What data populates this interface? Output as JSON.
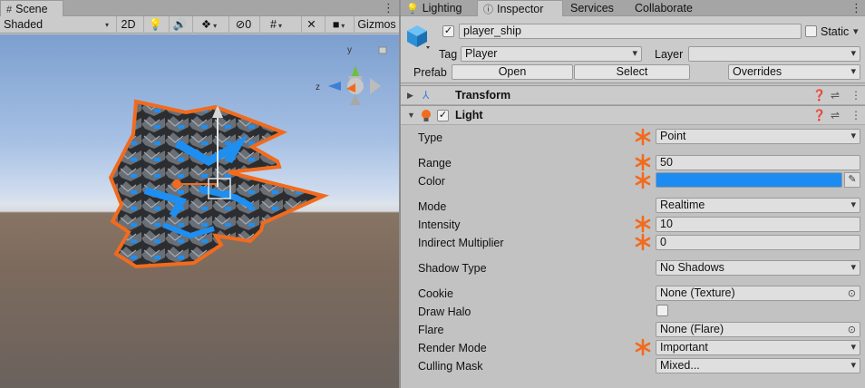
{
  "scene": {
    "tab_label": "Scene",
    "tab_icon": "grid-icon",
    "toolbar": {
      "shading_mode": "Shaded",
      "mode_2d": "2D",
      "hidden_count": "0",
      "gizmos_label": "Gizmos"
    },
    "axis_labels": {
      "y": "y",
      "z": "z"
    }
  },
  "inspector": {
    "tabs": [
      {
        "label": "Lighting",
        "icon": "lightbulb-icon"
      },
      {
        "label": "Inspector",
        "icon": "info-icon"
      },
      {
        "label": "Services"
      },
      {
        "label": "Collaborate"
      }
    ],
    "object_name": "player_ship",
    "static_label": "Static",
    "tag_label": "Tag",
    "tag_value": "Player",
    "layer_label": "Layer",
    "layer_value": "",
    "prefab_label": "Prefab",
    "prefab_open": "Open",
    "prefab_select": "Select",
    "prefab_overrides": "Overrides",
    "components": [
      {
        "name": "Transform",
        "expanded": false
      },
      {
        "name": "Light",
        "expanded": true,
        "enabled": true
      }
    ],
    "light_props": {
      "type_label": "Type",
      "type_value": "Point",
      "range_label": "Range",
      "range_value": "50",
      "color_label": "Color",
      "color_value": "#1d8cf2",
      "mode_label": "Mode",
      "mode_value": "Realtime",
      "intensity_label": "Intensity",
      "intensity_value": "10",
      "indirect_label": "Indirect Multiplier",
      "indirect_value": "0",
      "shadow_label": "Shadow Type",
      "shadow_value": "No Shadows",
      "cookie_label": "Cookie",
      "cookie_value": "None (Texture)",
      "halo_label": "Draw Halo",
      "halo_checked": false,
      "flare_label": "Flare",
      "flare_value": "None (Flare)",
      "render_label": "Render Mode",
      "render_value": "Important",
      "culling_label": "Culling Mask",
      "culling_value": "Mixed..."
    },
    "override_color": "#f26b1d"
  }
}
